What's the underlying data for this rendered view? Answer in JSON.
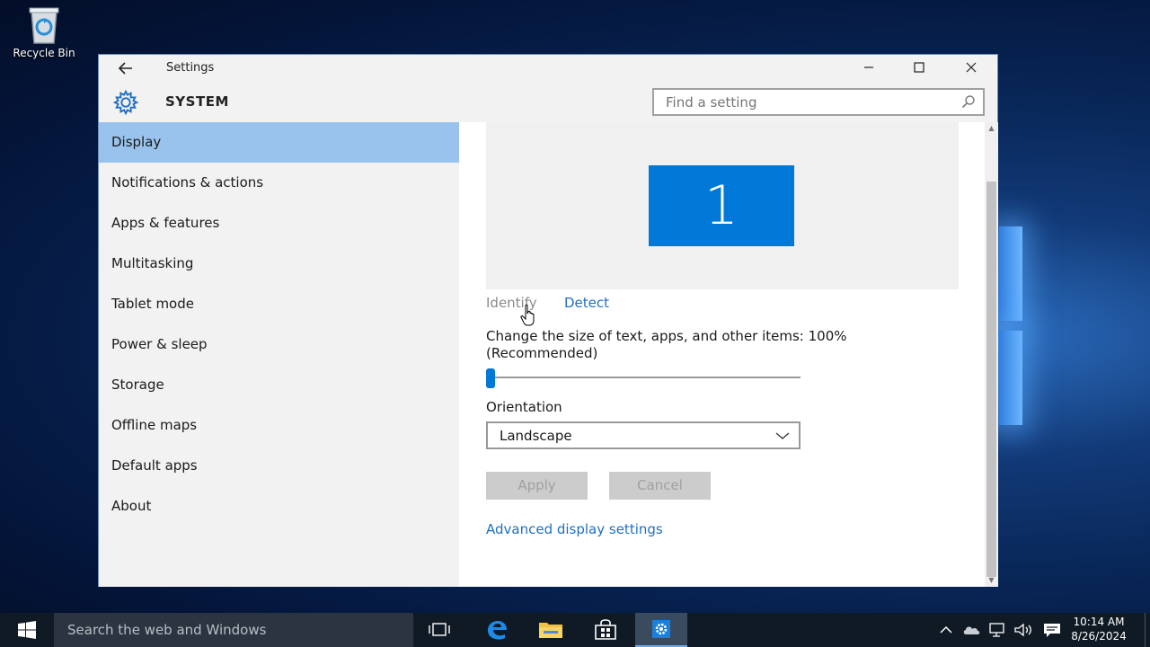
{
  "desktop": {
    "recycle_bin_label": "Recycle Bin"
  },
  "window": {
    "title": "Settings",
    "header_title": "SYSTEM",
    "search_placeholder": "Find a setting",
    "accent_color": "#0078d7",
    "selected_nav_color": "#99c3ec"
  },
  "sidebar": {
    "items": [
      {
        "label": "Display",
        "selected": true
      },
      {
        "label": "Notifications & actions",
        "selected": false
      },
      {
        "label": "Apps & features",
        "selected": false
      },
      {
        "label": "Multitasking",
        "selected": false
      },
      {
        "label": "Tablet mode",
        "selected": false
      },
      {
        "label": "Power & sleep",
        "selected": false
      },
      {
        "label": "Storage",
        "selected": false
      },
      {
        "label": "Offline maps",
        "selected": false
      },
      {
        "label": "Default apps",
        "selected": false
      },
      {
        "label": "About",
        "selected": false
      }
    ]
  },
  "display": {
    "monitor_number": "1",
    "identify_label": "Identify",
    "detect_label": "Detect",
    "scale_label": "Change the size of text, apps, and other items: 100% (Recommended)",
    "scale_slider_value": 0,
    "orientation_label": "Orientation",
    "orientation_value": "Landscape",
    "apply_label": "Apply",
    "cancel_label": "Cancel",
    "advanced_link": "Advanced display settings"
  },
  "taskbar": {
    "search_placeholder": "Search the web and Windows",
    "time": "10:14 AM",
    "date": "8/26/2024"
  }
}
